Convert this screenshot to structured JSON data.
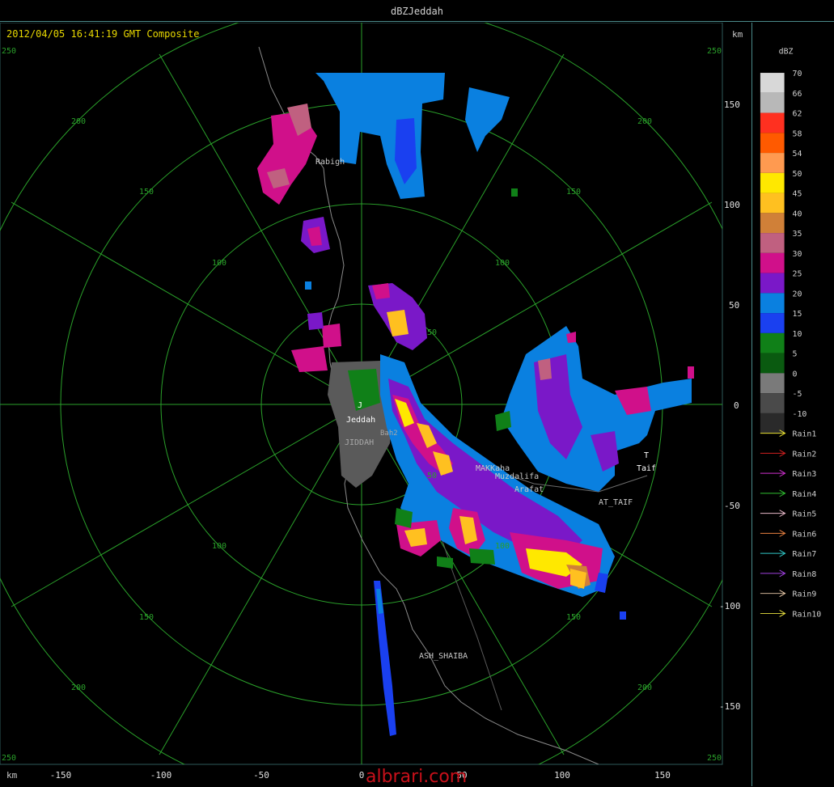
{
  "window": {
    "title": "dBZJeddah"
  },
  "header": {
    "timestamp": "2012/04/05 16:41:19 GMT Composite",
    "unit_km": "km"
  },
  "axes": {
    "unit": "km",
    "right_ticks": [
      "150",
      "100",
      "50",
      "0",
      "-50",
      "-100",
      "-150"
    ],
    "bottom_ticks": [
      "-150",
      "-100",
      "-50",
      "0",
      "50",
      "100",
      "150"
    ],
    "corner_labels": [
      "250",
      "250",
      "250",
      "250"
    ],
    "ring_labels": [
      "50",
      "100",
      "150",
      "200"
    ]
  },
  "places": [
    {
      "name": "Rabigh"
    },
    {
      "name": "Jeddah"
    },
    {
      "name": "JIDDAH"
    },
    {
      "name": "J"
    },
    {
      "name": "MAKKaha"
    },
    {
      "name": "Muzdalifa"
    },
    {
      "name": "Arafat"
    },
    {
      "name": "AT_TAIF"
    },
    {
      "name": "T"
    },
    {
      "name": "Taif"
    },
    {
      "name": "ASH_SHAIBA"
    },
    {
      "name": "Bah2"
    }
  ],
  "legend": {
    "title": "dBZ",
    "levels": [
      {
        "label": "70",
        "color": "#d8d8d8"
      },
      {
        "label": "66",
        "color": "#b8b8b8"
      },
      {
        "label": "62",
        "color": "#ff3020"
      },
      {
        "label": "58",
        "color": "#ff5a00"
      },
      {
        "label": "54",
        "color": "#ff9a50"
      },
      {
        "label": "50",
        "color": "#ffe800"
      },
      {
        "label": "45",
        "color": "#ffc020"
      },
      {
        "label": "40",
        "color": "#d08038"
      },
      {
        "label": "35",
        "color": "#c06080"
      },
      {
        "label": "30",
        "color": "#d0108a"
      },
      {
        "label": "25",
        "color": "#7a18c8"
      },
      {
        "label": "20",
        "color": "#0a80e0"
      },
      {
        "label": "15",
        "color": "#1a40f0"
      },
      {
        "label": "10",
        "color": "#108018"
      },
      {
        "label": "5",
        "color": "#0a5a10"
      },
      {
        "label": "0",
        "color": "#7a7a7a"
      },
      {
        "label": "-5",
        "color": "#4a4a4a"
      },
      {
        "label": "-10",
        "color": "#2a2a2a"
      }
    ]
  },
  "rain_tracks": [
    {
      "label": "Rain1",
      "color": "#e8e030"
    },
    {
      "label": "Rain2",
      "color": "#d02020"
    },
    {
      "label": "Rain3",
      "color": "#d030d0"
    },
    {
      "label": "Rain4",
      "color": "#30c030"
    },
    {
      "label": "Rain5",
      "color": "#e8b8c8"
    },
    {
      "label": "Rain6",
      "color": "#e88040"
    },
    {
      "label": "Rain7",
      "color": "#30c8c8"
    },
    {
      "label": "Rain8",
      "color": "#a040e0"
    },
    {
      "label": "Rain9",
      "color": "#e8c8a8"
    },
    {
      "label": "Rain10",
      "color": "#e8e040"
    }
  ],
  "watermark": "albrari.com"
}
